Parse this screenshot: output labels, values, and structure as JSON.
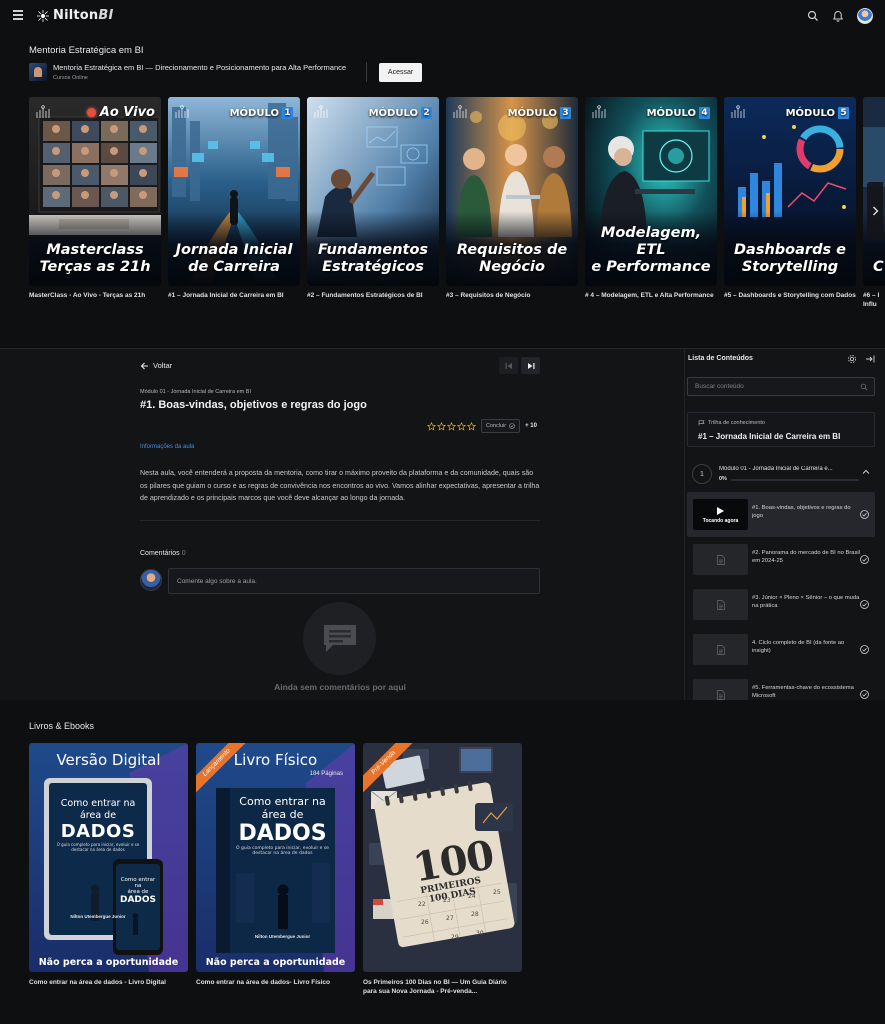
{
  "brand": {
    "name_main": "Nilton",
    "name_accent": "BI"
  },
  "icons": {
    "menu": "hamburger-icon",
    "search": "search-icon",
    "notifications": "bell-icon",
    "profile": "avatar"
  },
  "course": {
    "section_title": "Mentoria Estratégica em BI",
    "name": "Mentoria Estratégica em BI — Direcionamento e Posicionamento para Alta Performance",
    "type": "Cursos Online",
    "access_label": "Acessar"
  },
  "modules": [
    {
      "badge_live": "Ao Vivo",
      "overlay": [
        "Masterclass",
        "Terças as 21h"
      ],
      "caption": "MasterClass - Ao Vivo - Terças as 21h"
    },
    {
      "badge": "MÓDULO",
      "num": "1",
      "overlay": [
        "Jornada Inicial",
        "de Carreira"
      ],
      "caption": "#1 – Jornada Inicial de Carreira em BI"
    },
    {
      "badge": "MÓDULO",
      "num": "2",
      "overlay": [
        "Fundamentos",
        "Estratégicos"
      ],
      "caption": "#2 – Fundamentos Estratégicos de BI"
    },
    {
      "badge": "MÓDULO",
      "num": "3",
      "overlay": [
        "Requisitos de",
        "Negócio"
      ],
      "caption": "#3 – Requisitos de Negócio"
    },
    {
      "badge": "MÓDULO",
      "num": "4",
      "overlay": [
        "Modelagem, ETL",
        "e Performance"
      ],
      "caption": "# 4 – Modelagem, ETL e Alta Performance"
    },
    {
      "badge": "MÓDULO",
      "num": "5",
      "overlay": [
        "Dashboards e",
        "Storytelling"
      ],
      "caption": "#5 – Dashboards e Storytelling com Dados"
    },
    {
      "badge": "",
      "num": "",
      "overlay": [
        "C",
        ""
      ],
      "caption": "#6 – I Influ"
    }
  ],
  "lesson": {
    "back_label": "Voltar",
    "crumb": "Módulo 01 - Jornada Inicial de Carreira em BI",
    "title": "#1. Boas-vindas, objetivos e regras do jogo",
    "rating": 0,
    "rating_max": 5,
    "complete_label": "Concluir",
    "points": "+ 10",
    "info_link": "Informações da aula",
    "description": "Nesta aula, você entenderá a proposta da mentoria, como tirar o máximo proveito da plataforma e da comunidade, quais são os pilares que guiam o curso e as regras de convivência nos encontros ao vivo. Vamos alinhar expectativas, apresentar a trilha de aprendizado e os principais marcos que você deve alcançar ao longo da jornada.",
    "comments_label": "Comentários",
    "comments_count": "0",
    "comment_placeholder": "Comente algo sobre a aula.",
    "empty_comments": "Ainda sem comentários por aqui"
  },
  "sidebar": {
    "title": "Lista de Conteúdos",
    "search_placeholder": "Buscar conteúdo",
    "trail_label": "Trilha de conhecimento",
    "trail_name": "#1 – Jornada Inicial de Carreira em BI",
    "module_num": "1",
    "module_name": "Módulo 01 - Jornada Inicial de Carreira e...",
    "module_pct": "0%",
    "module_progress": 0,
    "playing_label": "Tocando agora",
    "lessons": [
      {
        "title": "#1. Boas-vindas, objetivos e regras do jogo",
        "active": true
      },
      {
        "title": "#2. Panorama do mercado de BI no Brasil em 2024-25",
        "active": false
      },
      {
        "title": "#3. Júnior × Pleno × Sênior – o que muda na prática",
        "active": false
      },
      {
        "title": "4. Ciclo completo de BI (da fonte ao insight)",
        "active": false
      },
      {
        "title": "#5. Ferramentas-chave do ecossistema Microsoft",
        "active": false
      }
    ]
  },
  "books": {
    "section_title": "Livros & Ebooks",
    "items": [
      {
        "heading": "Versão Digital",
        "ribbon": "",
        "sub": "",
        "cover_title": [
          "Como entrar na",
          "área de",
          "DADOS"
        ],
        "cover_sub": "O guia completo para iniciar, evoluir e se destacar na área de dados",
        "author": "Nilton Utemberguе Junior",
        "phone_title": [
          "Como entrar na",
          "área de",
          "DADOS"
        ],
        "footer": "Não perca a oportunidade",
        "caption": "Como entrar na área de dados - Livro Digital"
      },
      {
        "heading": "Livro Físico",
        "ribbon": "Lançamento",
        "sub": "184 Páginas",
        "cover_title": [
          "Como entrar na",
          "área de",
          "DADOS"
        ],
        "cover_sub": "O guia completo para iniciar, evoluir e se destacar na área de dados",
        "author": "Nilton Utemberguе Junior",
        "footer": "Não perca a oportunidade",
        "caption": "Como entrar na área de dados- Livro Físico"
      },
      {
        "heading": "",
        "ribbon": "Pré-Venda",
        "sub": "",
        "cover_big": "100",
        "cover_small": [
          "PRIMEIROS",
          "100 DIAS"
        ],
        "calendar": [
          "22",
          "23",
          "24",
          "25",
          "26",
          "27",
          "28",
          "29",
          "30"
        ],
        "footer": "",
        "caption": "Os Primeiros 100 Dias no BI — Um Guia Diário para sua Nova Jornada - Pré-venda..."
      }
    ]
  },
  "colors": {
    "accent_blue": "#2e86de",
    "link_blue": "#4a8fe0",
    "live_red": "#e74c3c",
    "ribbon_orange": "#e8732a",
    "star_gold": "#d4a73a",
    "page_bg": "#0e0f11",
    "panel_bg": "#131416"
  }
}
